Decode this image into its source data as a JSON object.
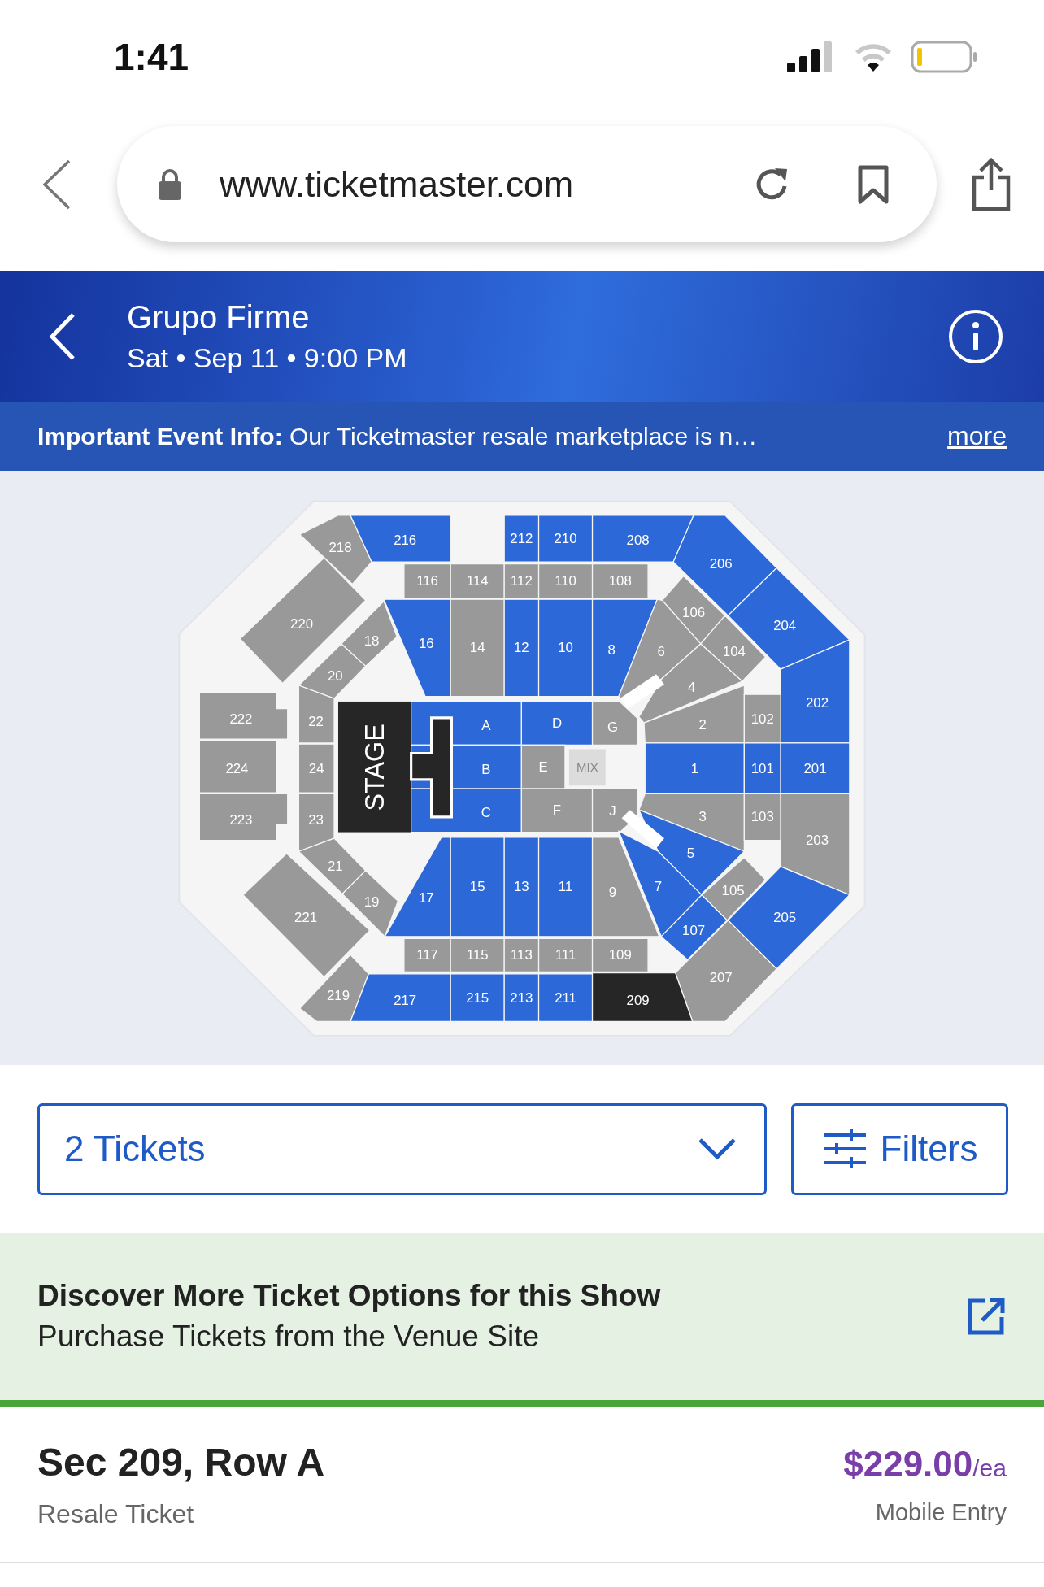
{
  "status_bar": {
    "time": "1:41"
  },
  "browser": {
    "url": "www.ticketmaster.com"
  },
  "event": {
    "title": "Grupo Firme",
    "date": "Sat • Sep 11 • 9:00 PM"
  },
  "notice": {
    "text": "**Important Event Info:** Our Ticketmaster resale marketplace is n…",
    "link": "more"
  },
  "map": {
    "stage": "STAGE",
    "mix": "MIX",
    "sections": [
      {
        "label": "218",
        "available": false,
        "selected": false
      },
      {
        "label": "216",
        "available": true,
        "selected": false
      },
      {
        "label": "212",
        "available": true,
        "selected": false
      },
      {
        "label": "210",
        "available": true,
        "selected": false
      },
      {
        "label": "208",
        "available": true,
        "selected": false
      },
      {
        "label": "206",
        "available": true,
        "selected": false
      },
      {
        "label": "116",
        "available": false,
        "selected": false
      },
      {
        "label": "114",
        "available": false,
        "selected": false
      },
      {
        "label": "112",
        "available": false,
        "selected": false
      },
      {
        "label": "110",
        "available": false,
        "selected": false
      },
      {
        "label": "108",
        "available": false,
        "selected": false
      },
      {
        "label": "106",
        "available": false,
        "selected": false
      },
      {
        "label": "220",
        "available": false,
        "selected": false
      },
      {
        "label": "204",
        "available": true,
        "selected": false
      },
      {
        "label": "18",
        "available": false,
        "selected": false
      },
      {
        "label": "16",
        "available": true,
        "selected": false
      },
      {
        "label": "14",
        "available": false,
        "selected": false
      },
      {
        "label": "12",
        "available": true,
        "selected": false
      },
      {
        "label": "10",
        "available": true,
        "selected": false
      },
      {
        "label": "8",
        "available": true,
        "selected": false
      },
      {
        "label": "6",
        "available": false,
        "selected": false
      },
      {
        "label": "104",
        "available": false,
        "selected": false
      },
      {
        "label": "20",
        "available": false,
        "selected": false
      },
      {
        "label": "4",
        "available": false,
        "selected": false
      },
      {
        "label": "202",
        "available": true,
        "selected": false
      },
      {
        "label": "222",
        "available": false,
        "selected": false
      },
      {
        "label": "22",
        "available": false,
        "selected": false
      },
      {
        "label": "A",
        "available": true,
        "selected": false
      },
      {
        "label": "D",
        "available": true,
        "selected": false
      },
      {
        "label": "G",
        "available": false,
        "selected": false
      },
      {
        "label": "2",
        "available": false,
        "selected": false
      },
      {
        "label": "102",
        "available": false,
        "selected": false
      },
      {
        "label": "224",
        "available": false,
        "selected": false
      },
      {
        "label": "24",
        "available": false,
        "selected": false
      },
      {
        "label": "B",
        "available": true,
        "selected": false
      },
      {
        "label": "E",
        "available": false,
        "selected": false
      },
      {
        "label": "1",
        "available": true,
        "selected": false
      },
      {
        "label": "101",
        "available": true,
        "selected": false
      },
      {
        "label": "201",
        "available": true,
        "selected": false
      },
      {
        "label": "223",
        "available": false,
        "selected": false
      },
      {
        "label": "23",
        "available": false,
        "selected": false
      },
      {
        "label": "C",
        "available": true,
        "selected": false
      },
      {
        "label": "F",
        "available": false,
        "selected": false
      },
      {
        "label": "J",
        "available": false,
        "selected": false
      },
      {
        "label": "3",
        "available": false,
        "selected": false
      },
      {
        "label": "103",
        "available": false,
        "selected": false
      },
      {
        "label": "203",
        "available": false,
        "selected": false
      },
      {
        "label": "21",
        "available": false,
        "selected": false
      },
      {
        "label": "5",
        "available": true,
        "selected": false
      },
      {
        "label": "19",
        "available": false,
        "selected": false
      },
      {
        "label": "17",
        "available": true,
        "selected": false
      },
      {
        "label": "15",
        "available": true,
        "selected": false
      },
      {
        "label": "13",
        "available": true,
        "selected": false
      },
      {
        "label": "11",
        "available": true,
        "selected": false
      },
      {
        "label": "9",
        "available": false,
        "selected": false
      },
      {
        "label": "7",
        "available": true,
        "selected": false
      },
      {
        "label": "105",
        "available": false,
        "selected": false
      },
      {
        "label": "221",
        "available": false,
        "selected": false
      },
      {
        "label": "107",
        "available": true,
        "selected": false
      },
      {
        "label": "205",
        "available": true,
        "selected": false
      },
      {
        "label": "117",
        "available": false,
        "selected": false
      },
      {
        "label": "115",
        "available": false,
        "selected": false
      },
      {
        "label": "113",
        "available": false,
        "selected": false
      },
      {
        "label": "111",
        "available": false,
        "selected": false
      },
      {
        "label": "109",
        "available": false,
        "selected": false
      },
      {
        "label": "207",
        "available": false,
        "selected": false
      },
      {
        "label": "219",
        "available": false,
        "selected": false
      },
      {
        "label": "217",
        "available": true,
        "selected": false
      },
      {
        "label": "215",
        "available": true,
        "selected": false
      },
      {
        "label": "213",
        "available": true,
        "selected": false
      },
      {
        "label": "211",
        "available": true,
        "selected": false
      },
      {
        "label": "209",
        "available": true,
        "selected": true
      }
    ]
  },
  "quantity": {
    "value": "2 Tickets"
  },
  "filters": {
    "label": "Filters"
  },
  "promo": {
    "title": "Discover More Ticket Options for this Show",
    "subtitle": "Purchase Tickets from the Venue Site"
  },
  "listing": {
    "section": "Sec 209, Row A",
    "type": "Resale Ticket",
    "price": "$229.00",
    "unit": "/ea",
    "delivery": "Mobile Entry"
  }
}
